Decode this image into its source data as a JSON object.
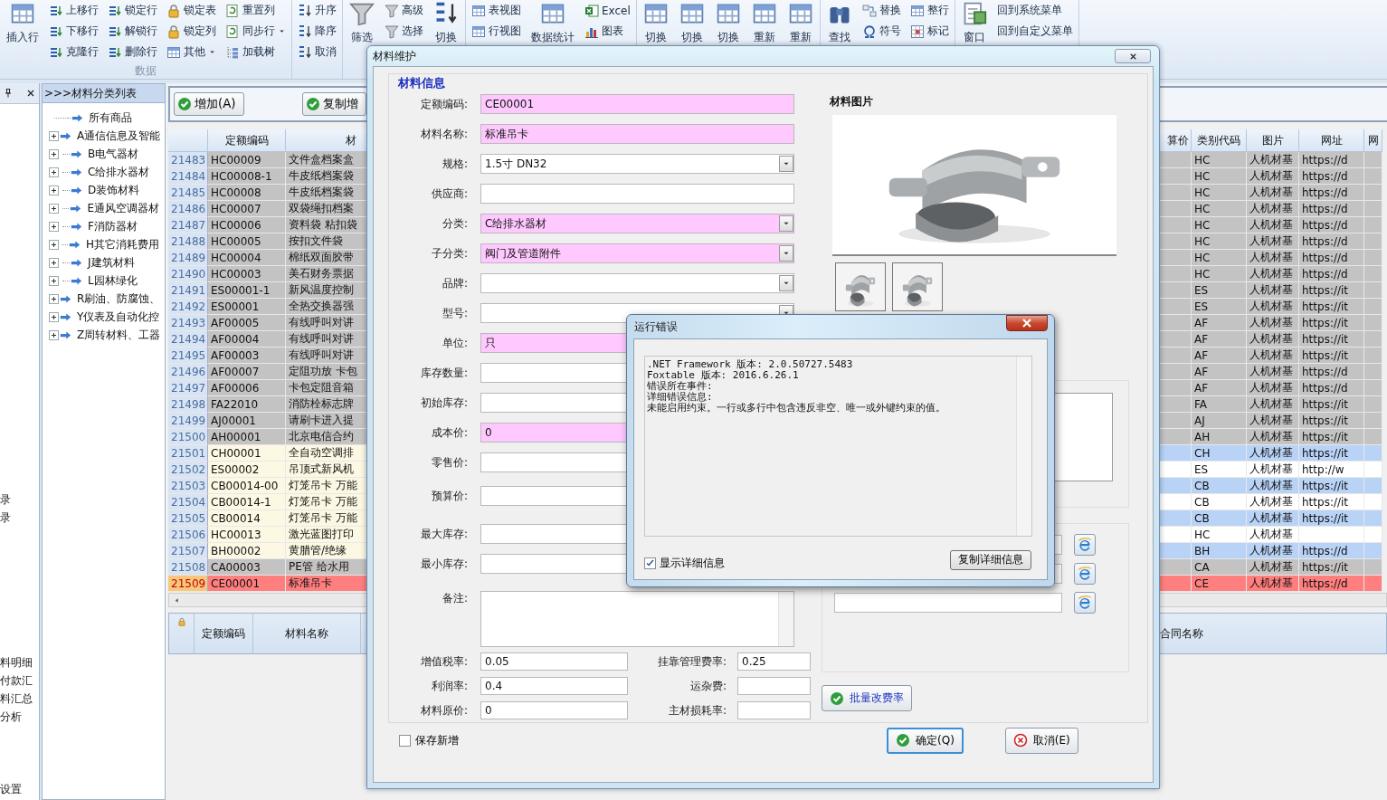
{
  "ribbon": {
    "groups": [
      {
        "label": "数据",
        "columns": [
          {
            "kind": "large",
            "items": [
              {
                "label": "插入行"
              }
            ]
          },
          {
            "kind": "stack",
            "items": [
              {
                "label": "上移行",
                "has_menu": false
              },
              {
                "label": "下移行",
                "has_menu": false
              },
              {
                "label": "克隆行",
                "has_menu": false
              }
            ]
          },
          {
            "kind": "stack",
            "items": [
              {
                "label": "锁定行",
                "has_menu": false
              },
              {
                "label": "解锁行",
                "has_menu": false
              },
              {
                "label": "删除行",
                "has_menu": false
              }
            ]
          },
          {
            "kind": "stack",
            "items": [
              {
                "label": "锁定表",
                "has_menu": false
              },
              {
                "label": "锁定列",
                "has_menu": false
              },
              {
                "label": "其他",
                "has_menu": true
              }
            ]
          },
          {
            "kind": "stack",
            "items": [
              {
                "label": "重置列",
                "has_menu": false
              },
              {
                "label": "同步行",
                "has_menu": true
              },
              {
                "label": "加载树",
                "has_menu": false
              }
            ]
          }
        ]
      },
      {
        "columns": [
          {
            "kind": "stack",
            "items": [
              {
                "label": "升序",
                "has_menu": false
              },
              {
                "label": "降序",
                "has_menu": false
              },
              {
                "label": "取消",
                "has_menu": false
              }
            ]
          }
        ]
      },
      {
        "columns": [
          {
            "kind": "large",
            "items": [
              {
                "label": "筛选"
              }
            ]
          },
          {
            "kind": "stack",
            "items": [
              {
                "label": "高级",
                "has_menu": false
              },
              {
                "label": "选择",
                "has_menu": false
              }
            ]
          },
          {
            "kind": "large",
            "items": [
              {
                "label": "切换"
              }
            ]
          }
        ]
      },
      {
        "columns": [
          {
            "kind": "stack",
            "items": [
              {
                "label": "表视图",
                "has_menu": false
              },
              {
                "label": "行视图",
                "has_menu": false
              }
            ]
          },
          {
            "kind": "large",
            "items": [
              {
                "label": "数据统计"
              }
            ]
          },
          {
            "kind": "stack",
            "items": [
              {
                "label": "Excel",
                "has_menu": false
              },
              {
                "label": "图表",
                "has_menu": false
              }
            ]
          }
        ]
      },
      {
        "columns": [
          {
            "kind": "large",
            "items": [
              {
                "label": "切换"
              },
              {
                "label": "切换"
              },
              {
                "label": "切换"
              },
              {
                "label": "重新"
              },
              {
                "label": "重新"
              }
            ]
          }
        ]
      },
      {
        "columns": [
          {
            "kind": "large",
            "items": [
              {
                "label": "查找"
              }
            ]
          },
          {
            "kind": "stack",
            "items": [
              {
                "label": "替换",
                "has_menu": false
              },
              {
                "label": "符号",
                "has_menu": false
              }
            ]
          },
          {
            "kind": "stack",
            "items": [
              {
                "label": "整行",
                "has_menu": false
              },
              {
                "label": "标记",
                "has_menu": false
              }
            ]
          }
        ]
      },
      {
        "columns": [
          {
            "kind": "large",
            "items": [
              {
                "label": "窗口"
              }
            ]
          },
          {
            "kind": "stack",
            "items": [
              {
                "label": "回到系统菜单",
                "has_menu": false
              },
              {
                "label": "回到自定义菜单",
                "has_menu": false
              }
            ]
          }
        ]
      }
    ]
  },
  "left_panel": {
    "sections": [
      [
        "录",
        "录"
      ],
      [
        "料明细",
        "付款汇",
        "料汇总",
        "分析"
      ],
      [
        "设置"
      ]
    ]
  },
  "tree": {
    "title": ">>>材料分类列表",
    "items": [
      {
        "label": "所有商品",
        "kind": "leaf"
      },
      {
        "label": "A通信信息及智能",
        "kind": "node",
        "expanded": false
      },
      {
        "label": "B电气器材",
        "kind": "node",
        "expanded": false
      },
      {
        "label": "C给排水器材",
        "kind": "node",
        "expanded": false
      },
      {
        "label": "D装饰材料",
        "kind": "node",
        "expanded": false
      },
      {
        "label": "E通风空调器材",
        "kind": "node",
        "expanded": false
      },
      {
        "label": "F消防器材",
        "kind": "node",
        "expanded": false
      },
      {
        "label": "H其它消耗费用",
        "kind": "node",
        "expanded": false
      },
      {
        "label": "J建筑材料",
        "kind": "node",
        "expanded": false
      },
      {
        "label": "L园林绿化",
        "kind": "node",
        "expanded": false
      },
      {
        "label": "R刷油、防腐蚀、",
        "kind": "node",
        "expanded": false
      },
      {
        "label": "Y仪表及自动化控",
        "kind": "node",
        "expanded": false
      },
      {
        "label": "Z周转材料、工器",
        "kind": "node",
        "expanded": false
      }
    ]
  },
  "toolbar": {
    "buttons": [
      "增加(A)",
      "复制增"
    ]
  },
  "grid": {
    "columns": [
      "定额编码",
      "材",
      "算价",
      "类别代码",
      "图片",
      "网址",
      "网"
    ],
    "rows": [
      {
        "number": "21483",
        "code": "HC00009",
        "name": "文件盒档案盒",
        "category": "HC",
        "picture": "人机材基",
        "url": "https://d",
        "locked": true,
        "selected": false
      },
      {
        "number": "21484",
        "code": "HC00008-1",
        "name": "牛皮纸档案袋",
        "category": "HC",
        "picture": "人机材基",
        "url": "https://d",
        "locked": true,
        "selected": false
      },
      {
        "number": "21485",
        "code": "HC00008",
        "name": "牛皮纸档案袋",
        "category": "HC",
        "picture": "人机材基",
        "url": "https://d",
        "locked": true,
        "selected": false
      },
      {
        "number": "21486",
        "code": "HC00007",
        "name": "双袋绳扣档案",
        "category": "HC",
        "picture": "人机材基",
        "url": "https://d",
        "locked": true,
        "selected": false
      },
      {
        "number": "21487",
        "code": "HC00006",
        "name": "资料袋 粘扣袋",
        "category": "HC",
        "picture": "人机材基",
        "url": "https://d",
        "locked": true,
        "selected": false
      },
      {
        "number": "21488",
        "code": "HC00005",
        "name": "按扣文件袋",
        "category": "HC",
        "picture": "人机材基",
        "url": "https://d",
        "locked": true,
        "selected": false
      },
      {
        "number": "21489",
        "code": "HC00004",
        "name": "棉纸双面胶带",
        "category": "HC",
        "picture": "人机材基",
        "url": "https://d",
        "locked": true,
        "selected": false
      },
      {
        "number": "21490",
        "code": "HC00003",
        "name": "美石财务票据",
        "category": "HC",
        "picture": "人机材基",
        "url": "https://d",
        "locked": true,
        "selected": false
      },
      {
        "number": "21491",
        "code": "ES00001-1",
        "name": "新风温度控制",
        "category": "ES",
        "picture": "人机材基",
        "url": "https://it",
        "locked": true,
        "selected": false
      },
      {
        "number": "21492",
        "code": "ES00001",
        "name": "全热交换器强",
        "category": "ES",
        "picture": "人机材基",
        "url": "https://it",
        "locked": true,
        "selected": false
      },
      {
        "number": "21493",
        "code": "AF00005",
        "name": "有线呼叫对讲",
        "category": "AF",
        "picture": "人机材基",
        "url": "https://it",
        "locked": true,
        "selected": false
      },
      {
        "number": "21494",
        "code": "AF00004",
        "name": "有线呼叫对讲",
        "category": "AF",
        "picture": "人机材基",
        "url": "https://it",
        "locked": true,
        "selected": false
      },
      {
        "number": "21495",
        "code": "AF00003",
        "name": "有线呼叫对讲",
        "category": "AF",
        "picture": "人机材基",
        "url": "https://it",
        "locked": true,
        "selected": false
      },
      {
        "number": "21496",
        "code": "AF00007",
        "name": "定阻功放 卡包",
        "category": "AF",
        "picture": "人机材基",
        "url": "https://d",
        "locked": true,
        "selected": false
      },
      {
        "number": "21497",
        "code": "AF00006",
        "name": "卡包定阻音箱",
        "category": "AF",
        "picture": "人机材基",
        "url": "https://d",
        "locked": true,
        "selected": false
      },
      {
        "number": "21498",
        "code": "FA22010",
        "name": "消防栓标志牌",
        "category": "FA",
        "picture": "人机材基",
        "url": "https://it",
        "locked": true,
        "selected": false
      },
      {
        "number": "21499",
        "code": "AJ00001",
        "name": "请刷卡进入提",
        "category": "AJ",
        "picture": "人机材基",
        "url": "https://it",
        "locked": true,
        "selected": false
      },
      {
        "number": "21500",
        "code": "AH00001",
        "name": "北京电信合约",
        "category": "AH",
        "picture": "人机材基",
        "url": "https://it",
        "locked": true,
        "selected": false
      },
      {
        "number": "21501",
        "code": "CH00001",
        "name": "全自动空调排",
        "category": "CH",
        "picture": "人机材基",
        "url": "https://it",
        "locked": false,
        "selected": false
      },
      {
        "number": "21502",
        "code": "ES00002",
        "name": "吊顶式新风机",
        "category": "ES",
        "picture": "人机材基",
        "url": "http://w",
        "locked": false,
        "selected": false
      },
      {
        "number": "21503",
        "code": "CB00014-00",
        "name": "灯笼吊卡 万能",
        "category": "CB",
        "picture": "人机材基",
        "url": "https://it",
        "locked": false,
        "selected": false
      },
      {
        "number": "21504",
        "code": "CB00014-1",
        "name": "灯笼吊卡 万能",
        "category": "CB",
        "picture": "人机材基",
        "url": "https://it",
        "locked": false,
        "selected": false
      },
      {
        "number": "21505",
        "code": "CB00014",
        "name": "灯笼吊卡 万能",
        "category": "CB",
        "picture": "人机材基",
        "url": "https://it",
        "locked": false,
        "selected": false
      },
      {
        "number": "21506",
        "code": "HC00013",
        "name": "激光蓝图打印",
        "category": "HC",
        "picture": "人机材基",
        "locked": false,
        "selected": false
      },
      {
        "number": "21507",
        "code": "BH00002",
        "name": "黄腊管/绝缘",
        "category": "BH",
        "picture": "人机材基",
        "url": "https://d",
        "locked": false,
        "selected": false
      },
      {
        "number": "21508",
        "code": "CA00003",
        "name": "PE管 给水用",
        "category": "CA",
        "picture": "人机材基",
        "url": "https://it",
        "locked": true,
        "selected": false
      },
      {
        "number": "21509",
        "code": "CE00001",
        "name": "标准吊卡",
        "category": "CE",
        "picture": "人机材基",
        "url": "https://d",
        "locked": false,
        "selected": true
      }
    ]
  },
  "detail_panel": {
    "columns": [
      "定额编码",
      "材料名称"
    ],
    "right_column": "合同名称"
  },
  "material_dialog": {
    "title": "材料维护",
    "section": "材料信息",
    "fields": [
      {
        "label": "定额编码:",
        "value": "CE00001",
        "kind": "text",
        "required": true
      },
      {
        "label": "材料名称:",
        "value": "标准吊卡",
        "kind": "text",
        "required": true
      },
      {
        "label": "规格:",
        "value": "1.5寸 DN32",
        "kind": "combo",
        "required": false
      },
      {
        "label": "供应商:",
        "kind": "text",
        "required": false
      },
      {
        "label": "分类:",
        "value": "C给排水器材",
        "kind": "combo",
        "required": true
      },
      {
        "label": "子分类:",
        "value": "阀门及管道附件",
        "kind": "combo",
        "required": true
      },
      {
        "label": "品牌:",
        "kind": "combo",
        "required": false
      },
      {
        "label": "型号:",
        "kind": "combo",
        "required": false
      },
      {
        "label": "单位:",
        "value": "只",
        "kind": "text",
        "required": true
      },
      {
        "label": "库存数量:",
        "kind": "text",
        "required": false
      },
      {
        "label": "初始库存:",
        "kind": "text",
        "required": false
      },
      {
        "label": "成本价:",
        "value": "0",
        "kind": "text",
        "required": true
      },
      {
        "label": "零售价:",
        "kind": "text",
        "required": false
      },
      {
        "label": "预算价:",
        "kind": "text",
        "required": false
      },
      {
        "label": "最大库存:",
        "kind": "text",
        "required": false
      },
      {
        "label": "最小库存:",
        "kind": "text",
        "required": false
      }
    ],
    "notes_label": "备注:",
    "rates": [
      {
        "label": "增值税率:",
        "value": "0.05"
      },
      {
        "label": "挂靠管理费率:",
        "value": "0.25"
      },
      {
        "label": "利润率:",
        "value": "0.4"
      },
      {
        "label": "运杂费:"
      },
      {
        "label": "材料原价:",
        "value": "0"
      },
      {
        "label": "主材损耗率:"
      }
    ],
    "picture_label": "材料图片",
    "link_rows": [
      {
        "kind": "url"
      },
      {
        "kind": "url"
      },
      {
        "kind": "url"
      }
    ],
    "batch_button": "批量改费率",
    "save_new": {
      "label": "保存新增",
      "checked": false
    },
    "ok_button": "确定(Q)",
    "cancel_button": "取消(E)"
  },
  "error_dialog": {
    "title": "运行错误",
    "lines": [
      ".NET Framework 版本: 2.0.50727.5483",
      "Foxtable 版本: 2016.6.26.1",
      "错误所在事件:",
      "详细错误信息:",
      "未能启用约束。一行或多行中包含违反非空、唯一或外键约束的值。"
    ],
    "show_details": {
      "label": "显示详细信息",
      "checked": true
    },
    "copy_button": "复制详细信息"
  }
}
